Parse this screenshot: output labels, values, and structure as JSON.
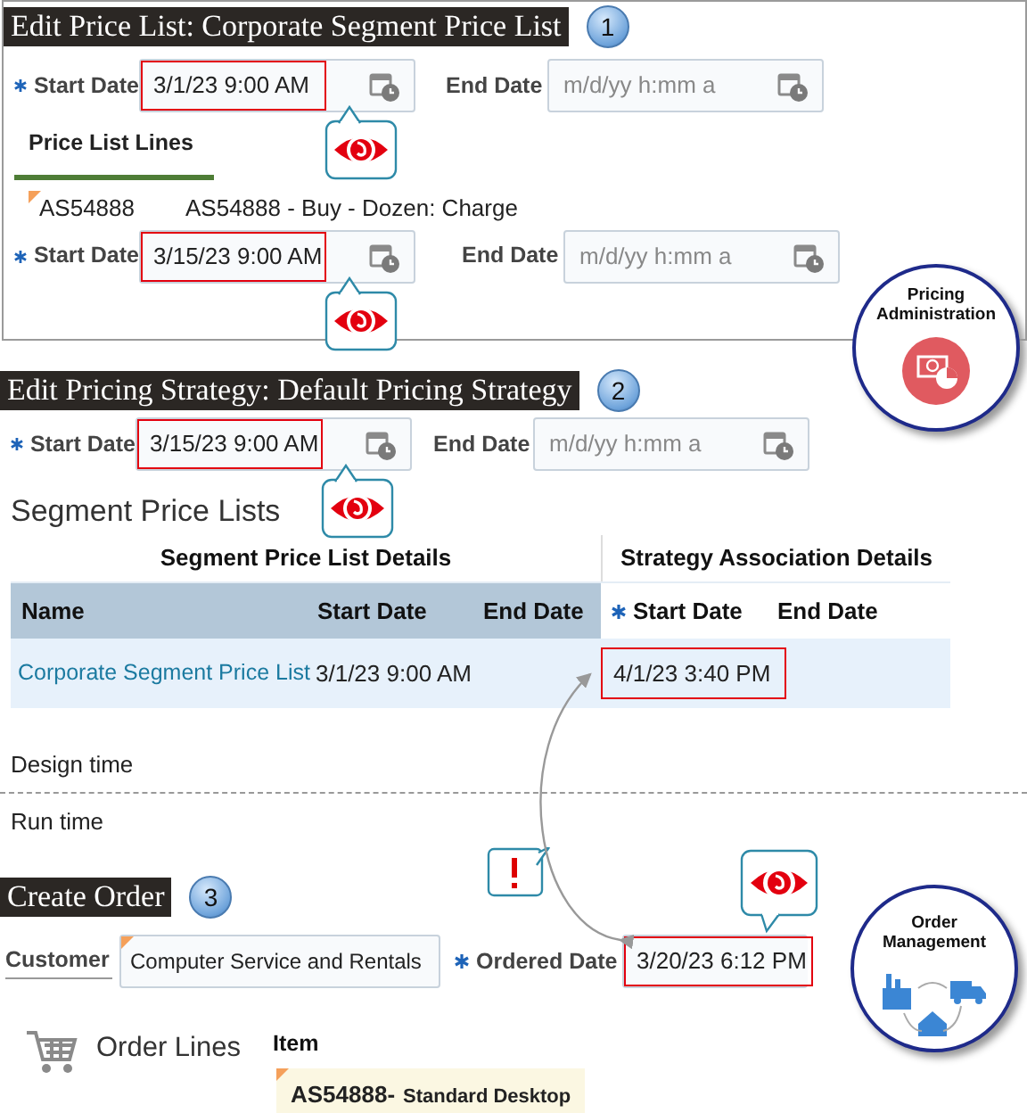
{
  "price_list_edit": {
    "title": "Edit Price List: Corporate Segment Price List",
    "step": "1",
    "start_date": {
      "label": "Start Date",
      "required": true,
      "value": "3/1/23 9:00 AM",
      "highlighted": true,
      "eye_callout": true
    },
    "end_date": {
      "label": "End Date",
      "required": false,
      "placeholder": "m/d/yy h:mm a",
      "highlighted": false,
      "eye_callout": false
    },
    "tab": {
      "label": "Price List Lines",
      "selected": true
    },
    "line": {
      "item": "AS54888",
      "description": "AS54888 - Buy - Dozen: Charge",
      "start_date": {
        "label": "Start Date",
        "required": true,
        "value": "3/15/23 9:00 AM",
        "highlighted": true,
        "eye_callout": true
      },
      "end_date": {
        "label": "End Date",
        "required": false,
        "placeholder": "m/d/yy h:mm a",
        "highlighted": false,
        "eye_callout": false
      }
    }
  },
  "pricing_administration": {
    "label": "Pricing Administration"
  },
  "pricing_strategy_edit": {
    "title": "Edit Pricing Strategy: Default Pricing Strategy",
    "step": "2",
    "start_date": {
      "label": "Start Date",
      "required": true,
      "value": "3/15/23 9:00 AM",
      "highlighted": true,
      "eye_callout": true
    },
    "end_date": {
      "label": "End Date",
      "required": false,
      "placeholder": "m/d/yy h:mm a",
      "highlighted": false,
      "eye_callout": false
    },
    "section_title": "Segment Price Lists",
    "table": {
      "group_headers": [
        "Segment Price List Details",
        "Strategy Association Details"
      ],
      "columns": [
        {
          "label": "Name",
          "required": false
        },
        {
          "label": "Start Date",
          "required": false
        },
        {
          "label": "End Date",
          "required": false
        },
        {
          "label": "Start Date",
          "required": true
        },
        {
          "label": "End Date",
          "required": false
        }
      ],
      "rows": [
        {
          "name": "Corporate Segment Price List",
          "start_date": "3/1/23 9:00 AM",
          "association_start_date": "4/1/23 3:40 PM",
          "highlighted": true
        }
      ]
    }
  },
  "design_time_label": "Design time",
  "run_time_label": "Run time",
  "create_order": {
    "title": "Create Order",
    "step": "3",
    "customer": {
      "label": "Customer",
      "value": "Computer Service and Rentals"
    },
    "ordered_date": {
      "label": "Ordered Date",
      "required": true,
      "value": "3/20/23 6:12 PM",
      "highlighted": true,
      "eye_callout": true
    },
    "order_lines_title": "Order Lines",
    "item_label": "Item",
    "item": {
      "number": "AS54888-",
      "description": "Standard Desktop"
    }
  },
  "order_management": {
    "label": "Order Management"
  }
}
